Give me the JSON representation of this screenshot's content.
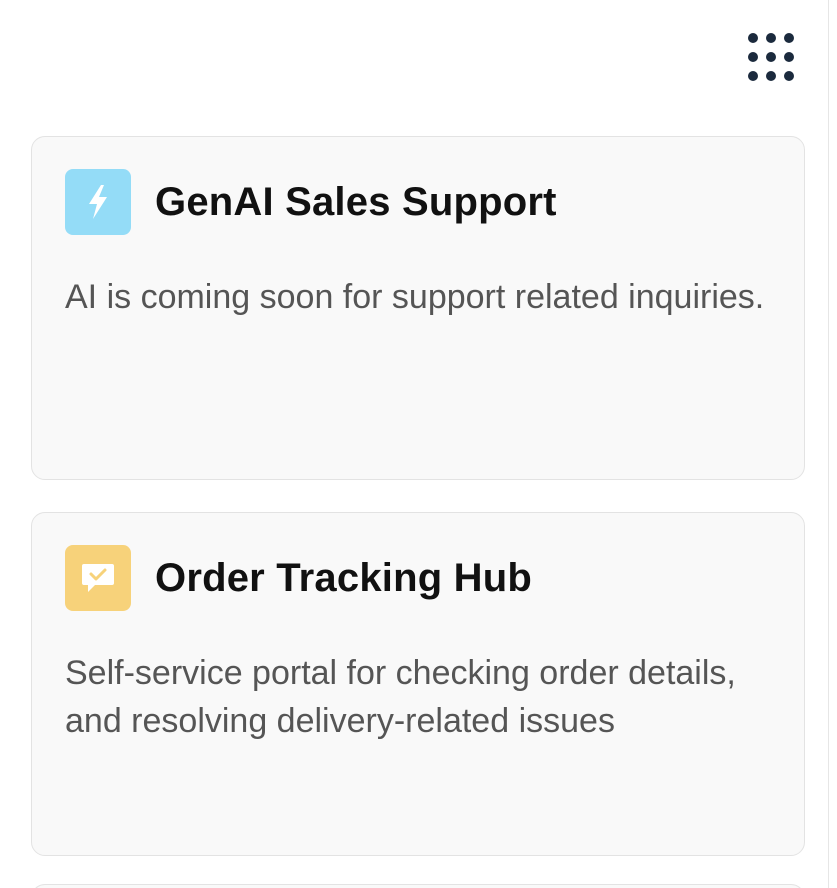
{
  "header": {
    "apps_icon": "grid-dots-icon"
  },
  "cards": [
    {
      "title": "GenAI Sales Support",
      "description": "AI is coming soon for support related inquiries.",
      "icon": "lightning-bolt-icon",
      "icon_bg": "#94dcf7",
      "icon_fg": "#ffffff"
    },
    {
      "title": "Order Tracking Hub",
      "description": "Self-service portal for checking order details, and resolving delivery-related issues",
      "icon": "chat-check-icon",
      "icon_bg": "#f7d27a",
      "icon_fg": "#ffffff"
    }
  ],
  "colors": {
    "card_bg": "#f9f9f9",
    "card_border": "#e3e3e3",
    "title_text": "#111111",
    "desc_text": "#555555",
    "apps_dots": "#1b2a3d"
  }
}
